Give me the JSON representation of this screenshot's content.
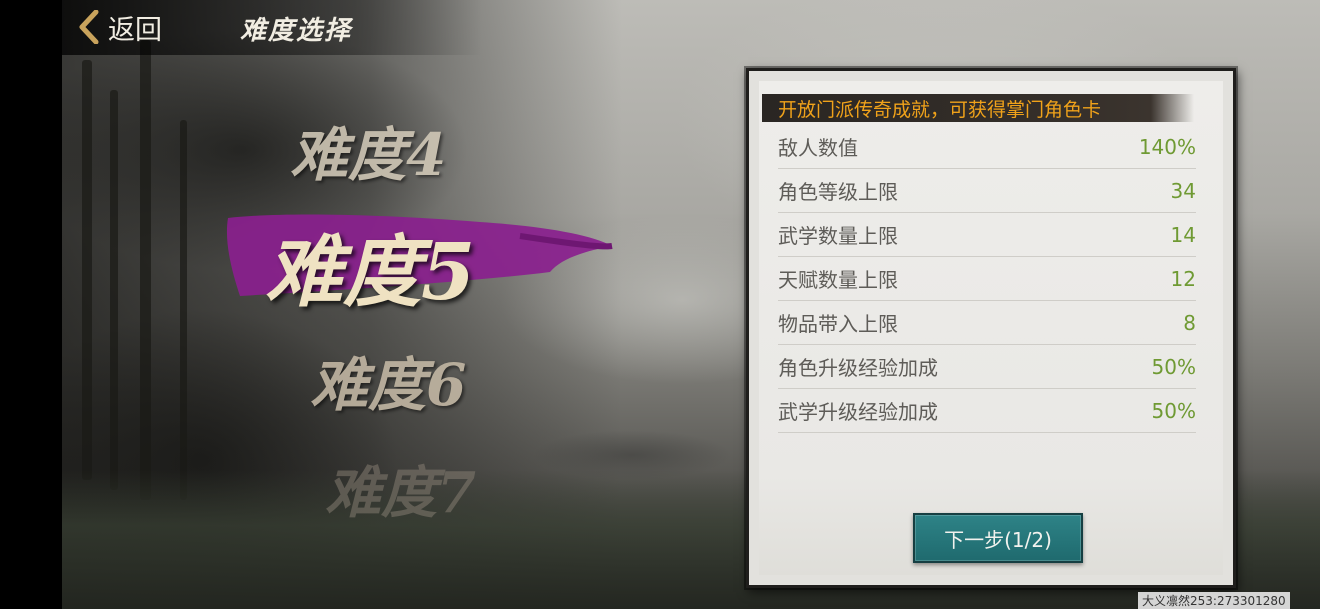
{
  "header": {
    "back_label": "返回",
    "title": "难度选择"
  },
  "difficulties": [
    {
      "label": "难度4",
      "selected": false
    },
    {
      "label": "难度5",
      "selected": true
    },
    {
      "label": "难度6",
      "selected": false
    },
    {
      "label": "难度7",
      "selected": false
    }
  ],
  "panel": {
    "banner": "开放门派传奇成就，可获得掌门角色卡",
    "stats": [
      {
        "label": "敌人数值",
        "value": "140%"
      },
      {
        "label": "角色等级上限",
        "value": "34"
      },
      {
        "label": "武学数量上限",
        "value": "14"
      },
      {
        "label": "天赋数量上限",
        "value": "12"
      },
      {
        "label": "物品带入上限",
        "value": "8"
      },
      {
        "label": "角色升级经验加成",
        "value": "50%"
      },
      {
        "label": "武学升级经验加成",
        "value": "50%"
      }
    ],
    "next_label": "下一步(1/2)"
  },
  "watermark": "大义凛然253:273301280",
  "colors": {
    "banner_text": "#f0a21a",
    "stat_value": "#6f9a33",
    "selected_stroke": "#8a1f8e",
    "next_button": "#2e8387"
  }
}
